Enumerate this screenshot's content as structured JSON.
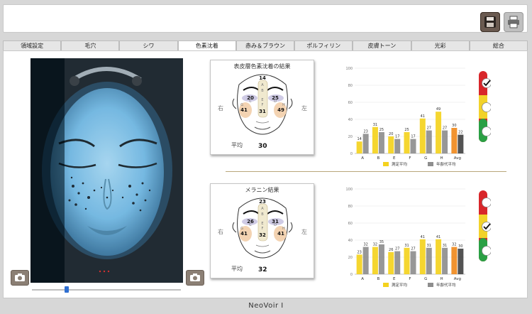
{
  "window": {
    "title": "NeoVoir I"
  },
  "toolbar": {
    "save_icon": "floppy-disk-icon",
    "print_icon": "printer-icon"
  },
  "tabs": [
    {
      "label": "領域設定",
      "active": false
    },
    {
      "label": "毛穴",
      "active": false
    },
    {
      "label": "シワ",
      "active": false
    },
    {
      "label": "色素沈着",
      "active": true
    },
    {
      "label": "赤み＆ブラウン",
      "active": false
    },
    {
      "label": "ポルフィリン",
      "active": false
    },
    {
      "label": "皮膚トーン",
      "active": false
    },
    {
      "label": "光彩",
      "active": false
    },
    {
      "label": "総合",
      "active": false
    }
  ],
  "photo": {
    "camera_left_icon": "camera-icon",
    "camera_right_icon": "camera-icon",
    "slider_value": 0.22
  },
  "face_cards": [
    {
      "title": "表皮層色素沈着の結果",
      "right_label": "右",
      "left_label": "左",
      "avg_label": "平均",
      "avg_value": "30",
      "zones": {
        "forehead": "14",
        "left_eye": "20",
        "right_eye": "25",
        "left_cheek": "41",
        "nose": "31",
        "right_cheek": "49"
      },
      "zone_letters": [
        "A",
        "B",
        "C",
        "D",
        "E",
        "F",
        "G",
        "H"
      ]
    },
    {
      "title": "メラニン結果",
      "right_label": "右",
      "left_label": "左",
      "avg_label": "平均",
      "avg_value": "32",
      "zones": {
        "forehead": "23",
        "left_eye": "26",
        "right_eye": "31",
        "left_cheek": "41",
        "nose": "32",
        "right_cheek": "41"
      },
      "zone_letters": [
        "A",
        "B",
        "C",
        "D",
        "E",
        "F",
        "G",
        "H"
      ]
    }
  ],
  "chart_data": [
    {
      "type": "bar",
      "categories": [
        "A",
        "B",
        "E",
        "F",
        "G",
        "H",
        "Avg"
      ],
      "series": [
        {
          "name": "測定平均",
          "values": [
            14,
            31,
            20,
            25,
            41,
            49,
            30
          ]
        },
        {
          "name": "年齢代平均",
          "values": [
            23,
            25,
            17,
            17,
            27,
            27,
            22
          ]
        }
      ],
      "ylim": [
        0,
        100
      ],
      "yticks": [
        0,
        20,
        40,
        60,
        80,
        100
      ],
      "legend": "bottom"
    },
    {
      "type": "bar",
      "categories": [
        "A",
        "B",
        "E",
        "F",
        "G",
        "H",
        "Avg"
      ],
      "series": [
        {
          "name": "測定平均",
          "values": [
            23,
            32,
            26,
            31,
            41,
            41,
            32
          ]
        },
        {
          "name": "年齢代平均",
          "values": [
            32,
            35,
            27,
            27,
            31,
            31,
            30
          ]
        }
      ],
      "ylim": [
        0,
        100
      ],
      "yticks": [
        0,
        20,
        40,
        60,
        80,
        100
      ],
      "legend": "bottom"
    }
  ],
  "colors": {
    "series_yellow": "#f4d21e",
    "series_gray": "#8e8e8e",
    "avg_orange": "#f08a1e",
    "avg_dark": "#444444",
    "traffic_red": "#d8262a",
    "traffic_yellow": "#f2d22a",
    "traffic_green": "#2aa044"
  },
  "indicators": [
    {
      "selected": "red"
    },
    {
      "selected": "yellow"
    }
  ]
}
